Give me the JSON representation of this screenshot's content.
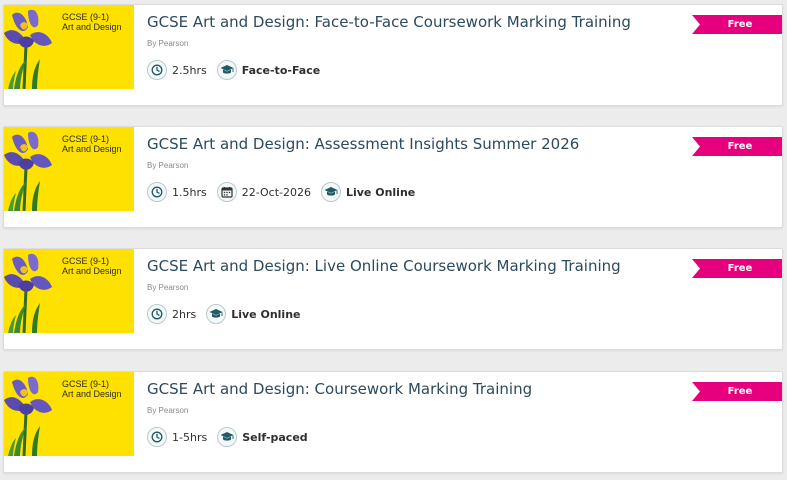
{
  "colors": {
    "accent": "#e6007e",
    "thumb_bg": "#ffe100",
    "title": "#2c4a5e"
  },
  "thumbnail_text": {
    "line1": "GCSE (9-1)",
    "line2": "Art and Design"
  },
  "courses": [
    {
      "title": "GCSE Art and Design: Face-to-Face Coursework Marking Training",
      "by": "By Pearson",
      "badge": "Free",
      "meta": [
        {
          "icon": "clock-icon",
          "text": "2.5hrs"
        },
        {
          "icon": "graduation-cap-icon",
          "text": "Face-to-Face"
        }
      ]
    },
    {
      "title": "GCSE Art and Design: Assessment Insights Summer 2026",
      "by": "By Pearson",
      "badge": "Free",
      "meta": [
        {
          "icon": "clock-icon",
          "text": "1.5hrs"
        },
        {
          "icon": "calendar-icon",
          "text": "22-Oct-2026"
        },
        {
          "icon": "graduation-cap-icon",
          "text": "Live Online"
        }
      ]
    },
    {
      "title": "GCSE Art and Design: Live Online Coursework Marking Training",
      "by": "By Pearson",
      "badge": "Free",
      "meta": [
        {
          "icon": "clock-icon",
          "text": "2hrs"
        },
        {
          "icon": "graduation-cap-icon",
          "text": "Live Online"
        }
      ]
    },
    {
      "title": "GCSE Art and Design: Coursework Marking Training",
      "by": "By Pearson",
      "badge": "Free",
      "meta": [
        {
          "icon": "clock-icon",
          "text": "1-5hrs"
        },
        {
          "icon": "graduation-cap-icon",
          "text": "Self-paced"
        }
      ]
    }
  ]
}
